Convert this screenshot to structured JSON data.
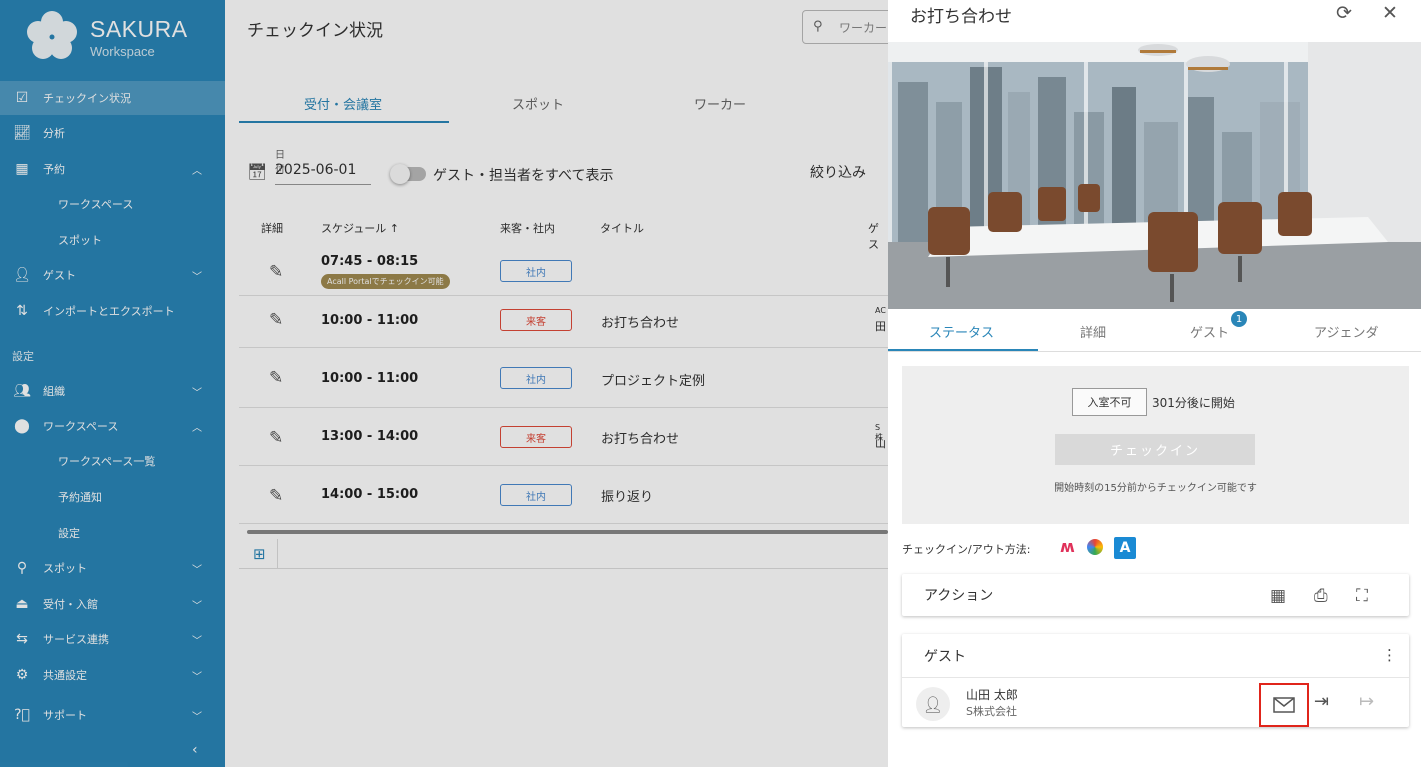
{
  "brand": {
    "name": "SAKURA",
    "subtitle": "Workspace"
  },
  "sidebar": {
    "items": [
      {
        "label": "チェックイン状況",
        "icon": "checkbox-icon",
        "active": true
      },
      {
        "label": "分析",
        "icon": "chart-line-icon"
      },
      {
        "label": "予約",
        "icon": "calendar-clock-icon",
        "expanded": true
      },
      {
        "label": "ワークスペース",
        "sub": true
      },
      {
        "label": "スポット",
        "sub": true
      },
      {
        "label": "ゲスト",
        "icon": "person-icon",
        "expanded": false
      },
      {
        "label": "インポートとエクスポート",
        "icon": "import-export-icon"
      },
      {
        "label": "組織",
        "icon": "group-icon",
        "expanded": false
      },
      {
        "label": "ワークスペース",
        "icon": "location-pin-icon",
        "expanded": true
      },
      {
        "label": "ワークスペース一覧",
        "sub": true
      },
      {
        "label": "予約通知",
        "sub": true
      },
      {
        "label": "設定",
        "sub": true
      },
      {
        "label": "スポット",
        "icon": "spot-pin-icon",
        "expanded": false
      },
      {
        "label": "受付・入館",
        "icon": "reception-bell-icon",
        "expanded": false
      },
      {
        "label": "サービス連携",
        "icon": "integration-icon",
        "expanded": false
      },
      {
        "label": "共通設定",
        "icon": "settings-icon",
        "expanded": false
      },
      {
        "label": "サポート",
        "icon": "help-icon",
        "expanded": false
      }
    ],
    "section_label": "設定"
  },
  "main": {
    "title": "チェックイン状況",
    "search_placeholder": "ワーカー",
    "tabs": [
      "受付・会議室",
      "スポット",
      "ワーカー"
    ],
    "date_label": "日付",
    "date_value": "2025-06-01",
    "toggle_label": "ゲスト・担当者をすべて表示",
    "filter_label": "絞り込み",
    "columns": [
      "詳細",
      "スケジュール ↑",
      "来客・社内",
      "タイトル",
      "ゲス"
    ],
    "rows": [
      {
        "time": "07:45 - 08:15",
        "type": "社内",
        "kind": "internal",
        "title": "",
        "tag": "Acall Portalでチェックイン可能",
        "guest1": "",
        "guest2": ""
      },
      {
        "time": "10:00 - 11:00",
        "type": "来客",
        "kind": "visitor",
        "title": "お打ち合わせ",
        "tag": "",
        "guest1": "AC",
        "guest2": "田"
      },
      {
        "time": "10:00 - 11:00",
        "type": "社内",
        "kind": "internal",
        "title": "プロジェクト定例",
        "tag": "",
        "guest1": "",
        "guest2": ""
      },
      {
        "time": "13:00 - 14:00",
        "type": "来客",
        "kind": "visitor",
        "title": "お打ち合わせ",
        "tag": "",
        "guest1": "S株",
        "guest2": "山"
      },
      {
        "time": "14:00 - 15:00",
        "type": "社内",
        "kind": "internal",
        "title": "振り返り",
        "tag": "",
        "guest1": "",
        "guest2": ""
      }
    ]
  },
  "panel": {
    "title": "お打ち合わせ",
    "tabs": [
      "ステータス",
      "詳細",
      "ゲスト",
      "アジェンダ"
    ],
    "guest_count": "1",
    "entry_status": "入室不可",
    "start_text": "301分後に開始",
    "checkin_button": "チェックイン",
    "hint": "開始時刻の15分前からチェックイン可能です",
    "method_label": "チェックイン/アウト方法:",
    "action_title": "アクション",
    "guest_title": "ゲスト",
    "guest": {
      "name": "山田 太郎",
      "company": "S株式会社"
    }
  },
  "colors": {
    "sidebar": "#2a86b8",
    "accent": "#2a86b8",
    "visitor": "#e04a3a",
    "internal": "#4a8ad0",
    "highlight": "#e0251b"
  }
}
